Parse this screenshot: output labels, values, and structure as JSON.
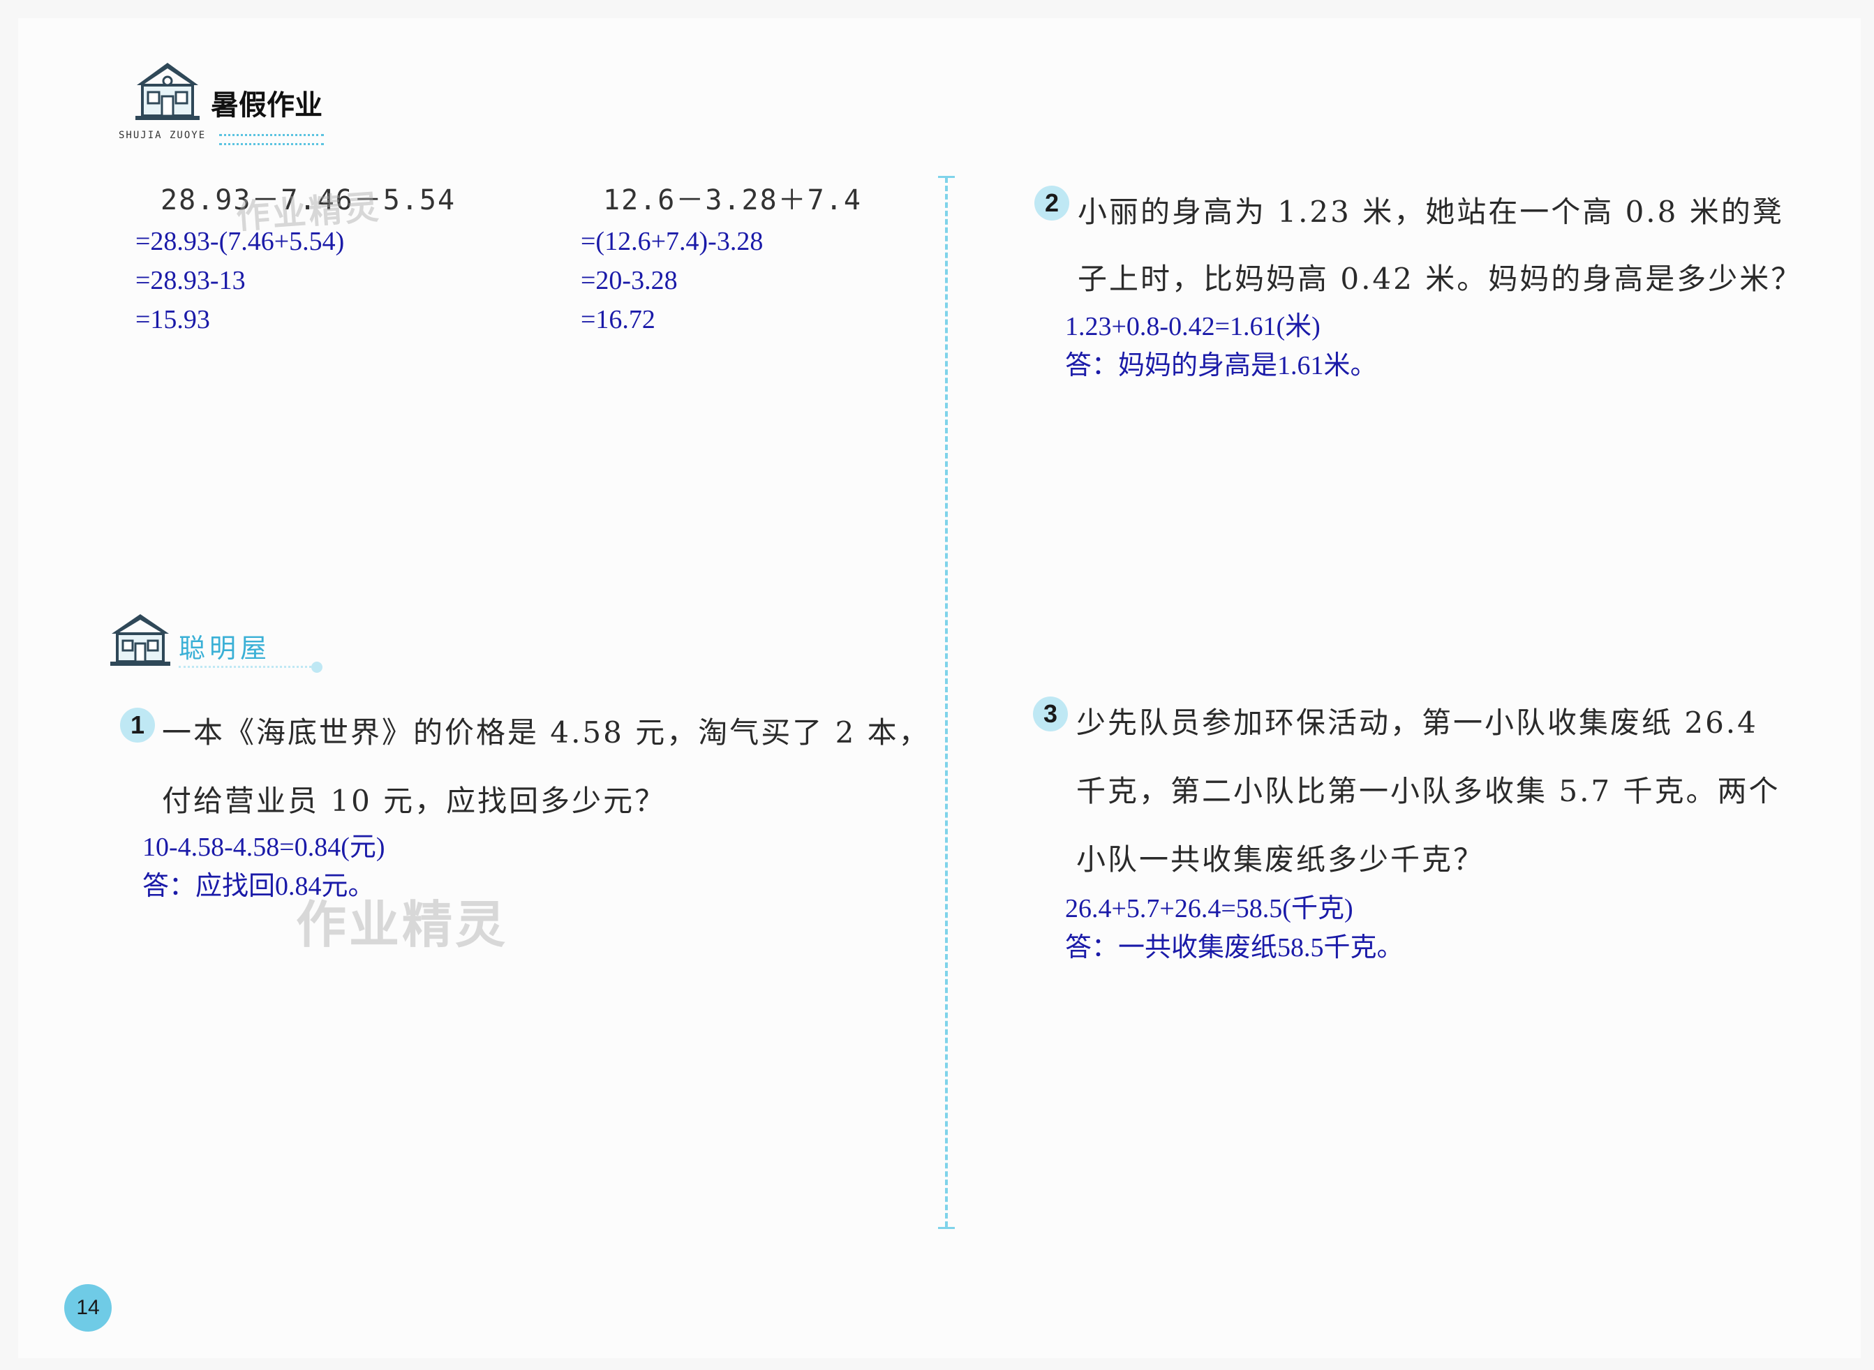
{
  "header": {
    "title": "暑假作业",
    "subtitle": "SHUJIA ZUOYE"
  },
  "calculations": [
    {
      "expression": "28.93－7.46－5.54",
      "steps": [
        "=28.93-(7.46+5.54)",
        "=28.93-13",
        "=15.93"
      ]
    },
    {
      "expression": "12.6－3.28＋7.4",
      "steps": [
        "=(12.6+7.4)-3.28",
        "=20-3.28",
        "=16.72"
      ]
    }
  ],
  "section": {
    "title": "聪明屋"
  },
  "problems": [
    {
      "number": "1",
      "lines": [
        "一本《海底世界》的价格是 4.58 元，淘气买了 2 本，",
        "付给营业员 10 元，应找回多少元？"
      ],
      "answer": [
        "10-4.58-4.58=0.84(元)",
        "答：应找回0.84元。"
      ]
    },
    {
      "number": "2",
      "lines": [
        "小丽的身高为 1.23 米，她站在一个高 0.8 米的凳",
        "子上时，比妈妈高 0.42 米。妈妈的身高是多少米？"
      ],
      "answer": [
        "1.23+0.8-0.42=1.61(米)",
        "答：妈妈的身高是1.61米。"
      ]
    },
    {
      "number": "3",
      "lines": [
        "少先队员参加环保活动，第一小队收集废纸 26.4",
        "千克，第二小队比第一小队多收集 5.7 千克。两个",
        "小队一共收集废纸多少千克？"
      ],
      "answer": [
        "26.4+5.7+26.4=58.5(千克)",
        "答：一共收集废纸58.5千克。"
      ]
    }
  ],
  "watermark": "作业精灵",
  "page_number": "14",
  "colors": {
    "answer": "#1a1aa8",
    "badge": "#bfe8f4",
    "divider": "#7fd3ea"
  }
}
